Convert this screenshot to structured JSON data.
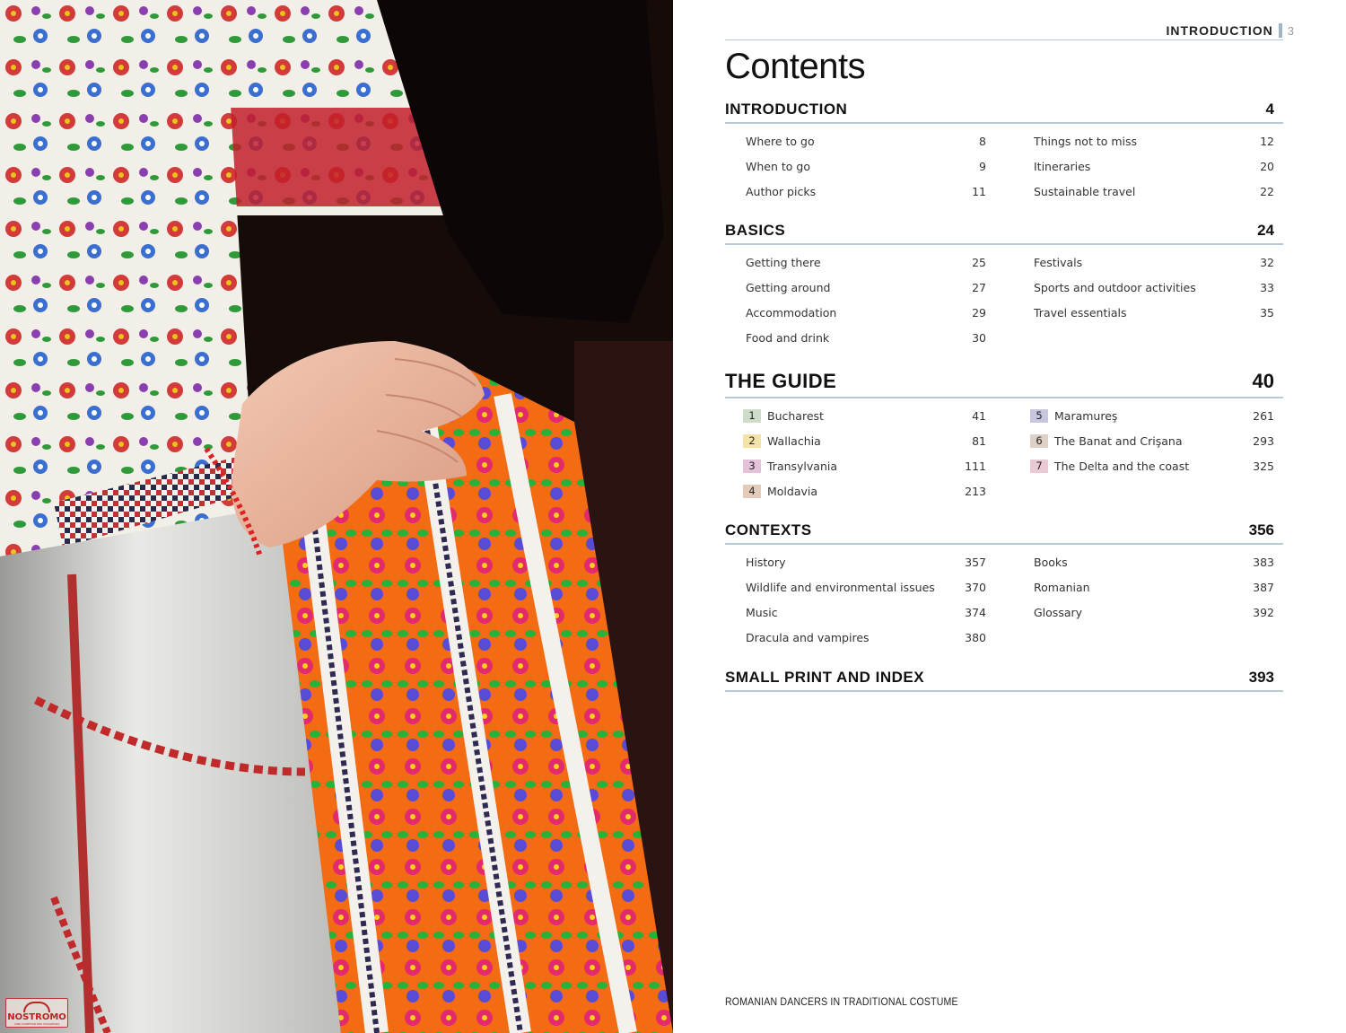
{
  "running_head": {
    "label": "INTRODUCTION",
    "page_number": "3"
  },
  "title": "Contents",
  "sections": {
    "introduction": {
      "title": "INTRODUCTION",
      "page": "4",
      "left": [
        {
          "label": "Where to go",
          "page": "8"
        },
        {
          "label": "When to go",
          "page": "9"
        },
        {
          "label": "Author picks",
          "page": "11"
        }
      ],
      "right": [
        {
          "label": "Things not to miss",
          "page": "12"
        },
        {
          "label": "Itineraries",
          "page": "20"
        },
        {
          "label": "Sustainable travel",
          "page": "22"
        }
      ]
    },
    "basics": {
      "title": "BASICS",
      "page": "24",
      "left": [
        {
          "label": "Getting there",
          "page": "25"
        },
        {
          "label": "Getting around",
          "page": "27"
        },
        {
          "label": "Accommodation",
          "page": "29"
        },
        {
          "label": "Food and drink",
          "page": "30"
        }
      ],
      "right": [
        {
          "label": "Festivals",
          "page": "32"
        },
        {
          "label": "Sports and outdoor activities",
          "page": "33"
        },
        {
          "label": "Travel essentials",
          "page": "35"
        }
      ]
    },
    "guide": {
      "title": "THE GUIDE",
      "page": "40",
      "left": [
        {
          "num": "1",
          "label": "Bucharest",
          "page": "41",
          "color": "#cfdcc9"
        },
        {
          "num": "2",
          "label": "Wallachia",
          "page": "81",
          "color": "#f3e3a6"
        },
        {
          "num": "3",
          "label": "Transylvania",
          "page": "111",
          "color": "#e4c3da"
        },
        {
          "num": "4",
          "label": "Moldavia",
          "page": "213",
          "color": "#e3cbbb"
        }
      ],
      "right": [
        {
          "num": "5",
          "label": "Maramureş",
          "page": "261",
          "color": "#c8c6df"
        },
        {
          "num": "6",
          "label": "The Banat and Crişana",
          "page": "293",
          "color": "#dcd0c7"
        },
        {
          "num": "7",
          "label": "The Delta and the coast",
          "page": "325",
          "color": "#e9c9d3"
        }
      ]
    },
    "contexts": {
      "title": "CONTEXTS",
      "page": "356",
      "left": [
        {
          "label": "History",
          "page": "357"
        },
        {
          "label": "Wildlife and environmental issues",
          "page": "370"
        },
        {
          "label": "Music",
          "page": "374"
        },
        {
          "label": "Dracula and vampires",
          "page": "380"
        }
      ],
      "right": [
        {
          "label": "Books",
          "page": "383"
        },
        {
          "label": "Romanian",
          "page": "387"
        },
        {
          "label": "Glossary",
          "page": "392"
        }
      ]
    },
    "small_print": {
      "title": "SMALL PRINT AND INDEX",
      "page": "393"
    }
  },
  "caption": "ROMANIAN DANCERS IN TRADITIONAL COSTUME",
  "logo": {
    "word": "NOSTROMO",
    "sub": "VIDE-COMPTOIR DES VOYAGEURS"
  }
}
